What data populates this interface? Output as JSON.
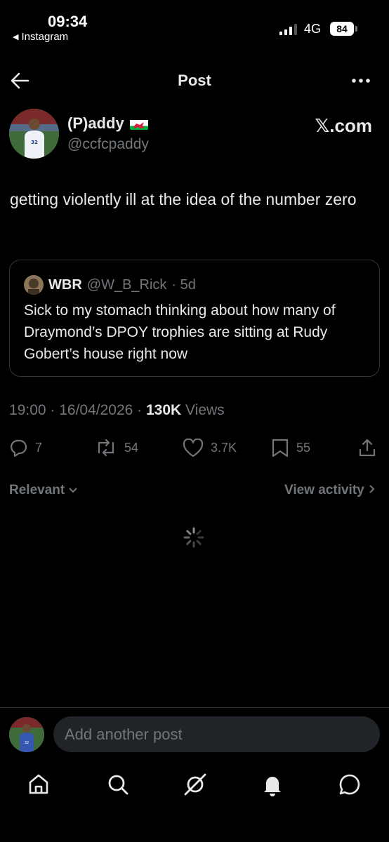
{
  "status_bar": {
    "time": "09:34",
    "back_app": "Instagram",
    "network": "4G",
    "battery": "84"
  },
  "header": {
    "title": "Post"
  },
  "post": {
    "display_name": "(P)addy",
    "handle": "@ccfcpaddy",
    "brand": "𝕏.com",
    "text": "getting violently ill at the idea of the number zero",
    "timestamp": "19:00 · 16/04/2026 · ",
    "views_count": "130K",
    "views_label": " Views"
  },
  "quote": {
    "name": "WBR",
    "handle": "@W_B_Rick",
    "age": "· 5d",
    "text": "Sick to my stomach thinking about how many of Draymond’s DPOY trophies are sitting at Rudy Gobert’s house right now"
  },
  "actions": {
    "replies": "7",
    "reposts": "54",
    "likes": "3.7K",
    "bookmarks": "55"
  },
  "replies_bar": {
    "sort_label": "Relevant",
    "view_activity": "View activity"
  },
  "compose": {
    "placeholder": "Add another post"
  },
  "icons": [
    "back-arrow-icon",
    "more-icon",
    "wales-flag-icon",
    "reply-icon",
    "repost-icon",
    "like-icon",
    "bookmark-icon",
    "share-icon",
    "spinner-icon",
    "home-icon",
    "search-icon",
    "grok-icon",
    "notifications-icon",
    "messages-icon"
  ],
  "colors": {
    "background": "#000000",
    "text": "#e7e9ea",
    "muted": "#71767b",
    "border": "#333639"
  }
}
